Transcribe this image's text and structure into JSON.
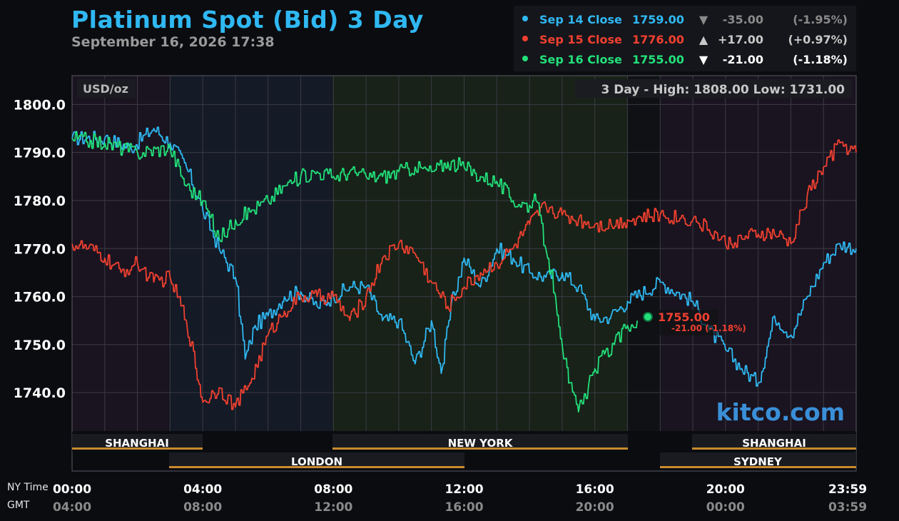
{
  "header": {
    "title": "Platinum Spot (Bid) 3 Day",
    "subtitle": "September 16, 2026 17:38"
  },
  "legend": [
    {
      "label": "Sep 14 Close",
      "value": "1759.00",
      "arrow": "▼",
      "change": "-35.00",
      "percent": "(-1.95%)",
      "color": "#2fb8f2",
      "change_color": "#8a8a8a"
    },
    {
      "label": "Sep 15 Close",
      "value": "1776.00",
      "arrow": "▲",
      "change": "+17.00",
      "percent": "(+0.97%)",
      "color": "#f04030",
      "change_color": "#c8c8c8"
    },
    {
      "label": "Sep 16 Close",
      "value": "1755.00",
      "arrow": "▼",
      "change": "-21.00",
      "percent": "(-1.18%)",
      "color": "#22e07a",
      "change_color": "#ffffff"
    }
  ],
  "plot": {
    "units": "USD/oz",
    "high_low": "3 Day - High: 1808.00  Low: 1731.00",
    "watermark": "kitco.com",
    "current_price": "1755.00",
    "current_change": "-21.00 (-1.18%)"
  },
  "sessions_row1": [
    "SHANGHAI",
    "NEW YORK",
    "SHANGHAI"
  ],
  "sessions_row2": [
    "LONDON",
    "SYDNEY"
  ],
  "footer": {
    "ny_label": "NY Time",
    "gmt_label": "GMT",
    "ny_times": [
      "00:00",
      "04:00",
      "08:00",
      "12:00",
      "16:00",
      "20:00",
      "23:59"
    ],
    "gmt_times": [
      "04:00",
      "08:00",
      "12:00",
      "16:00",
      "20:00",
      "00:00",
      "03:59"
    ]
  },
  "colors": {
    "sep14": "#2fb8f2",
    "sep15": "#f04030",
    "sep16": "#22e07a",
    "accent": "#2fb8f2",
    "session_bar": "#c98a2e"
  },
  "chart_data": {
    "type": "line",
    "title": "Platinum Spot (Bid) 3 Day",
    "ylabel": "USD/oz",
    "xlabel": "NY Time",
    "x_ticks": [
      "00:00",
      "04:00",
      "08:00",
      "12:00",
      "16:00",
      "20:00",
      "23:59"
    ],
    "y_ticks": [
      "1740.0",
      "1750.0",
      "1760.0",
      "1770.0",
      "1780.0",
      "1790.0",
      "1800.0"
    ],
    "ylim": [
      1732,
      1806
    ],
    "xlim": [
      0,
      24
    ],
    "grid": true,
    "series": [
      {
        "name": "Sep 14",
        "color": "#2fb8f2",
        "x": [
          0,
          1.0,
          1.8,
          2.5,
          3.0,
          3.5,
          4.0,
          4.5,
          5.0,
          5.3,
          5.6,
          6.0,
          6.5,
          7.0,
          7.5,
          8.0,
          8.5,
          9.0,
          9.5,
          10.0,
          10.5,
          11.0,
          11.3,
          11.6,
          12.0,
          12.5,
          13.0,
          13.5,
          14.0,
          14.5,
          15.0,
          15.5,
          16.0,
          16.5,
          17.0,
          18.0,
          19.0,
          19.5,
          20.0,
          20.5,
          21.0,
          21.5,
          22.0,
          22.5,
          23.0,
          23.5,
          24.0
        ],
        "y": [
          1793,
          1793,
          1791,
          1795,
          1792,
          1787,
          1778,
          1770,
          1764,
          1747,
          1754,
          1756,
          1760,
          1761,
          1758,
          1760,
          1762,
          1762,
          1755,
          1755,
          1746,
          1755,
          1744,
          1758,
          1768,
          1762,
          1770,
          1768,
          1765,
          1764,
          1765,
          1762,
          1755,
          1756,
          1759,
          1763,
          1759,
          1753,
          1749,
          1745,
          1742,
          1756,
          1752,
          1760,
          1767,
          1771,
          1770
        ]
      },
      {
        "name": "Sep 15",
        "color": "#f04030",
        "x": [
          0,
          0.5,
          1.0,
          1.5,
          2.0,
          2.5,
          3.0,
          3.5,
          4.0,
          4.5,
          5.0,
          5.5,
          6.0,
          6.5,
          7.0,
          7.5,
          8.0,
          8.5,
          9.0,
          9.5,
          10.0,
          10.5,
          11.0,
          11.5,
          12.0,
          12.5,
          13.0,
          13.5,
          14.0,
          14.5,
          15.0,
          15.5,
          16.0,
          16.5,
          17.0,
          18.0,
          19.0,
          19.5,
          20.0,
          20.5,
          21.0,
          21.5,
          22.0,
          22.5,
          23.0,
          23.5,
          24.0
        ],
        "y": [
          1771,
          1770,
          1768,
          1765,
          1767,
          1763,
          1764,
          1755,
          1738,
          1741,
          1737,
          1743,
          1752,
          1757,
          1760,
          1760,
          1760,
          1755,
          1760,
          1768,
          1771,
          1769,
          1763,
          1758,
          1762,
          1765,
          1767,
          1770,
          1775,
          1779,
          1777,
          1776,
          1775,
          1775,
          1776,
          1777,
          1776,
          1774,
          1771,
          1772,
          1773,
          1773,
          1771,
          1781,
          1787,
          1792,
          1790
        ]
      },
      {
        "name": "Sep 16",
        "color": "#22e07a",
        "x": [
          0,
          1.0,
          2.0,
          3.0,
          3.5,
          4.0,
          4.5,
          5.0,
          5.5,
          6.0,
          6.5,
          7.0,
          7.5,
          8.0,
          8.5,
          9.0,
          9.5,
          10.0,
          10.5,
          11.0,
          11.5,
          12.0,
          12.5,
          13.0,
          13.5,
          14.0,
          14.2,
          14.5,
          14.8,
          15.0,
          15.2,
          15.5,
          15.8,
          16.0,
          16.3,
          16.6,
          17.0,
          17.3
        ],
        "y": [
          1793,
          1792,
          1790,
          1791,
          1783,
          1780,
          1772,
          1776,
          1778,
          1780,
          1783,
          1785,
          1786,
          1785,
          1786,
          1785,
          1785,
          1786,
          1787,
          1786,
          1788,
          1787,
          1785,
          1784,
          1780,
          1779,
          1780,
          1770,
          1760,
          1750,
          1742,
          1736,
          1741,
          1745,
          1748,
          1750,
          1754,
          1755
        ]
      }
    ]
  }
}
